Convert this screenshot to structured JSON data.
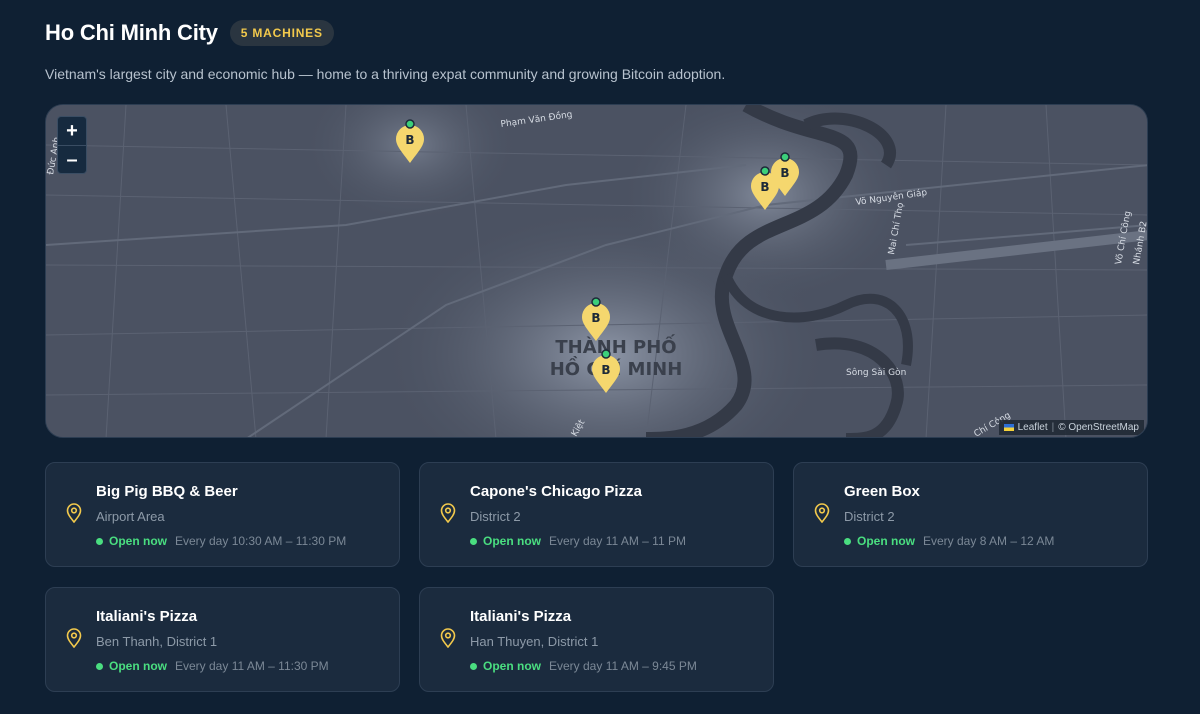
{
  "city": {
    "title": "Ho Chi Minh City",
    "badge": "5 MACHINES",
    "description": "Vietnam's largest city and economic hub — home to a thriving expat community and growing Bitcoin adoption."
  },
  "map": {
    "zoom_in": "+",
    "zoom_out": "–",
    "attribution_leaflet": "Leaflet",
    "attribution_sep": "|",
    "attribution_osm": "© OpenStreetMap",
    "city_label_line1": "THÀNH PHỐ",
    "city_label_line2": "HỒ CHÍ MINH",
    "street_labels": [
      "Phạm Văn Đồng",
      "Võ Nguyên Giáp",
      "Mai Chí Thọ",
      "Võ Chí Công",
      "Nhánh B2",
      "Sông Sài Gòn",
      "Chí Công",
      "Đức Anh",
      "Kiệt"
    ],
    "pin_glyph": "B",
    "icons": {
      "zoom_in": "plus-icon",
      "zoom_out": "minus-icon",
      "pin": "bitcoin-map-pin-icon"
    }
  },
  "locations": [
    {
      "name": "Big Pig BBQ & Beer",
      "area": "Airport Area",
      "status": "Open now",
      "hours": "Every day 10:30 AM – 11:30 PM"
    },
    {
      "name": "Capone's Chicago Pizza",
      "area": "District 2",
      "status": "Open now",
      "hours": "Every day 11 AM – 11 PM"
    },
    {
      "name": "Green Box",
      "area": "District 2",
      "status": "Open now",
      "hours": "Every day 8 AM – 12 AM"
    },
    {
      "name": "Italiani's Pizza",
      "area": "Ben Thanh, District 1",
      "status": "Open now",
      "hours": "Every day 11 AM – 11:30 PM"
    },
    {
      "name": "Italiani's Pizza",
      "area": "Han Thuyen, District 1",
      "status": "Open now",
      "hours": "Every day 11 AM – 9:45 PM"
    }
  ],
  "colors": {
    "background": "#0f2033",
    "card": "#1b2b3e",
    "accent_yellow": "#f2c94c",
    "open_green": "#4ade80",
    "pin_yellow": "#f5d76e"
  }
}
